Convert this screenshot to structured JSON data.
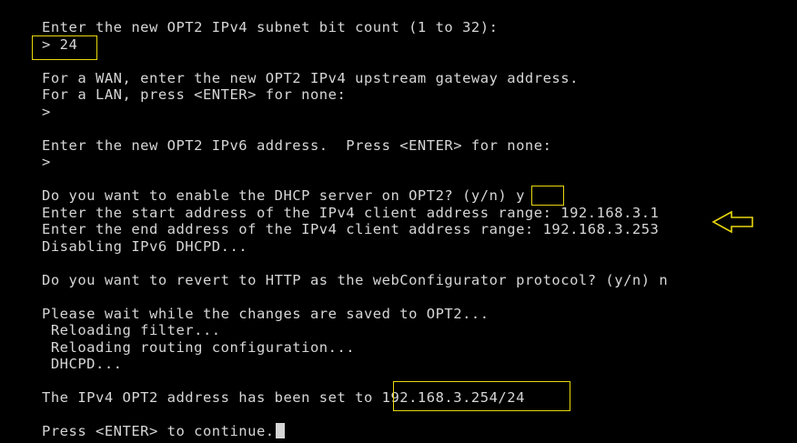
{
  "terminal": {
    "lines": [
      "Enter the new OPT2 IPv4 subnet bit count (1 to 32):",
      "> 24",
      "",
      "For a WAN, enter the new OPT2 IPv4 upstream gateway address.",
      "For a LAN, press <ENTER> for none:",
      ">",
      "",
      "Enter the new OPT2 IPv6 address.  Press <ENTER> for none:",
      ">",
      "",
      "Do you want to enable the DHCP server on OPT2? (y/n) y",
      "Enter the start address of the IPv4 client address range: 192.168.3.1",
      "Enter the end address of the IPv4 client address range: 192.168.3.253",
      "Disabling IPv6 DHCPD...",
      "",
      "Do you want to revert to HTTP as the webConfigurator protocol? (y/n) n",
      "",
      "Please wait while the changes are saved to OPT2...",
      " Reloading filter...",
      " Reloading routing configuration...",
      " DHCPD...",
      "",
      "The IPv4 OPT2 address has been set to 192.168.3.254/24",
      "",
      "Press <ENTER> to continue."
    ]
  },
  "colors": {
    "background": "#000000",
    "text": "#d6d6d6",
    "highlight": "#e8d70c"
  },
  "icons": {
    "arrow": "left-arrow-icon"
  }
}
